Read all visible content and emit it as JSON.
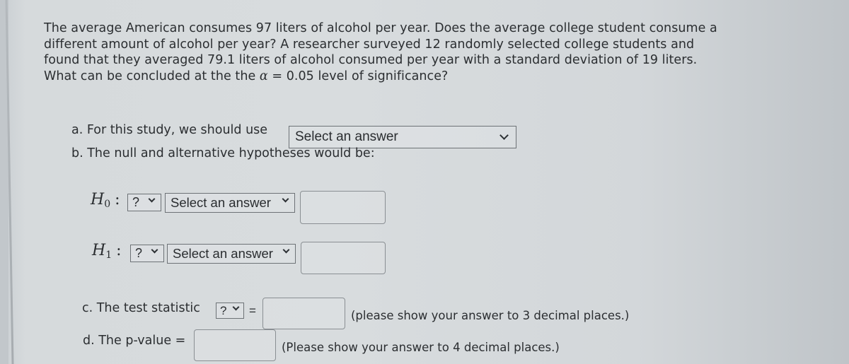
{
  "question": {
    "line1": "The average American consumes 97 liters of alcohol per year. Does the average college student consume a",
    "line2": "different amount of alcohol per year? A researcher surveyed 12 randomly selected college students and",
    "line3": "found that they averaged 79.1 liters of alcohol consumed per year with a standard deviation of 19 liters.",
    "line4_prefix": "What can be concluded at the the ",
    "alpha_symbol": "α",
    "line4_suffix": " = 0.05 level of significance?"
  },
  "part_a": {
    "label": "a. For this study, we should use",
    "select_value": "Select an answer"
  },
  "part_b": {
    "label": "b. The null and alternative hypotheses would be:"
  },
  "h0": {
    "symbol": "H",
    "subscript": "0",
    "colon": ":",
    "parameter_select": "?",
    "operator_select": "Select an answer",
    "value": ""
  },
  "h1": {
    "symbol": "H",
    "subscript": "1",
    "colon": ":",
    "parameter_select": "?",
    "operator_select": "Select an answer",
    "value": ""
  },
  "part_c": {
    "label": "c. The test statistic",
    "statistic_select": "?",
    "equals": "=",
    "value": "",
    "hint": "(please show your answer to 3 decimal places.)"
  },
  "part_d": {
    "label": "d. The p-value =",
    "value": "",
    "hint": "(Please show your answer to 4 decimal places.)"
  }
}
